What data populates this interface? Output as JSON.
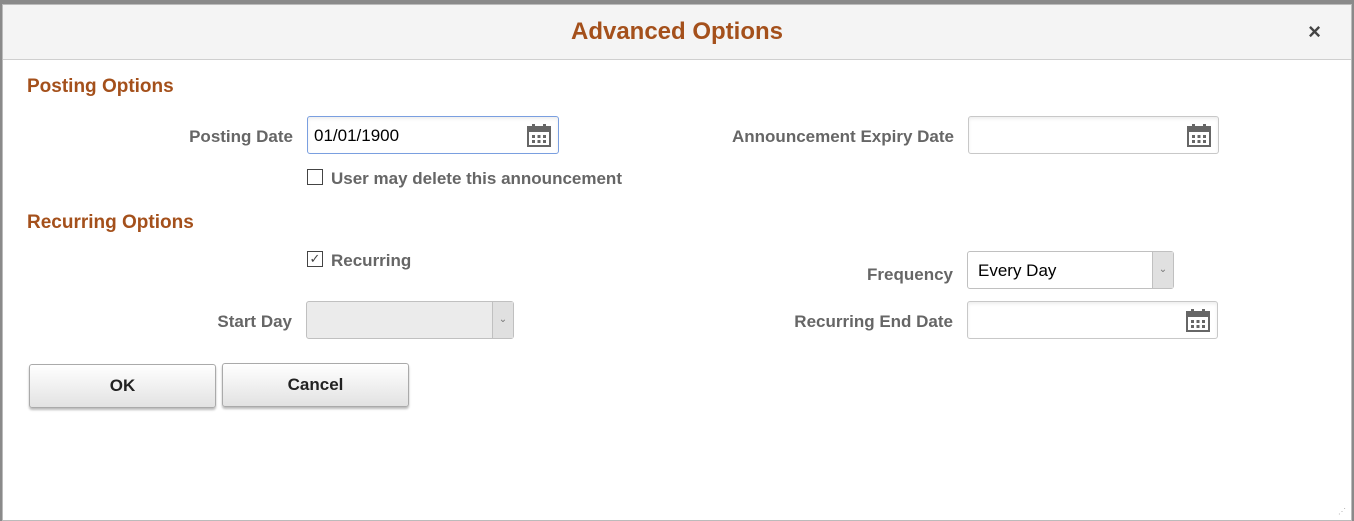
{
  "dialog": {
    "title": "Advanced Options",
    "close_label": "×"
  },
  "posting": {
    "heading": "Posting Options",
    "posting_date_label": "Posting Date",
    "posting_date_value": "01/01/1900",
    "expiry_label": "Announcement Expiry Date",
    "expiry_value": "",
    "delete_label": "User may delete this announcement",
    "delete_checked": false
  },
  "recurring": {
    "heading": "Recurring Options",
    "recurring_label": "Recurring",
    "recurring_checked": true,
    "recurring_mark": "✓",
    "frequency_label": "Frequency",
    "frequency_value": "Every Day",
    "start_day_label": "Start Day",
    "start_day_value": "",
    "end_date_label": "Recurring End Date",
    "end_date_value": ""
  },
  "buttons": {
    "ok": "OK",
    "cancel": "Cancel"
  },
  "colors": {
    "heading": "#a4501b",
    "label": "#666666"
  }
}
